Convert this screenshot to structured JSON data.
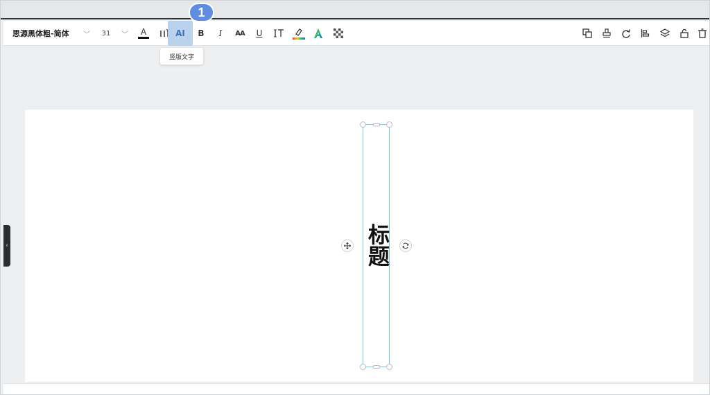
{
  "toolbar": {
    "font_name": "思源黑体粗-简体",
    "font_size": "31",
    "vertical_text_label": "AI",
    "bold_label": "B",
    "italic_label": "I",
    "underline_label": "U",
    "spacing_label": "AA"
  },
  "badge": {
    "number": "1"
  },
  "tooltip": {
    "text": "竖版文字"
  },
  "canvas": {
    "text": "标题"
  },
  "colors": {
    "accent": "#5f8ee0",
    "selection": "#6ccbea",
    "active_button": "#b9d3ee"
  }
}
